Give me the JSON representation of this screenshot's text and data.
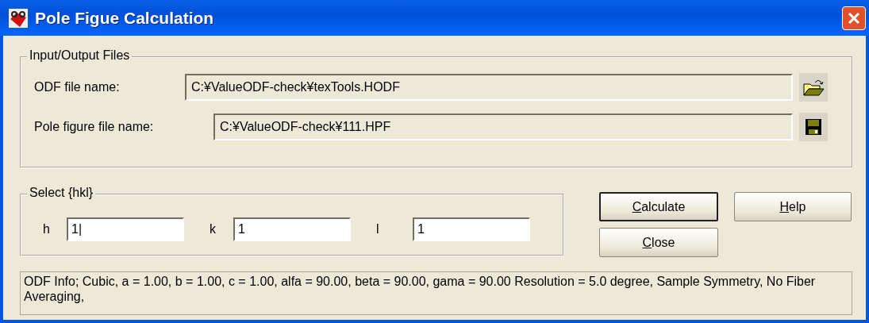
{
  "window": {
    "title": "Pole Figue Calculation"
  },
  "files_group": {
    "title": "Input/Output Files",
    "rows": [
      {
        "label": "ODF file name:",
        "value": "C:¥ValueODF-check¥texTools.HODF",
        "kind": "open"
      },
      {
        "label": "Pole figure file name:",
        "value": "C:¥ValueODF-check¥111.HPF",
        "kind": "save"
      }
    ]
  },
  "hkl_group": {
    "title": "Select {hkl}",
    "fields": [
      {
        "label": "h",
        "value": "1|"
      },
      {
        "label": "k",
        "value": "1"
      },
      {
        "label": "l",
        "value": "1"
      }
    ]
  },
  "buttons": [
    {
      "label": "Calculate",
      "default": true
    },
    {
      "label": "Help",
      "default": false
    },
    {
      "label": "Close",
      "default": false
    }
  ],
  "info": "ODF Info; Cubic, a = 1.00, b = 1.00, c = 1.00, alfa = 90.00, beta = 90.00, gama = 90.00 Resolution = 5.0 degree, Sample Symmetry, No Fiber Averaging,"
}
